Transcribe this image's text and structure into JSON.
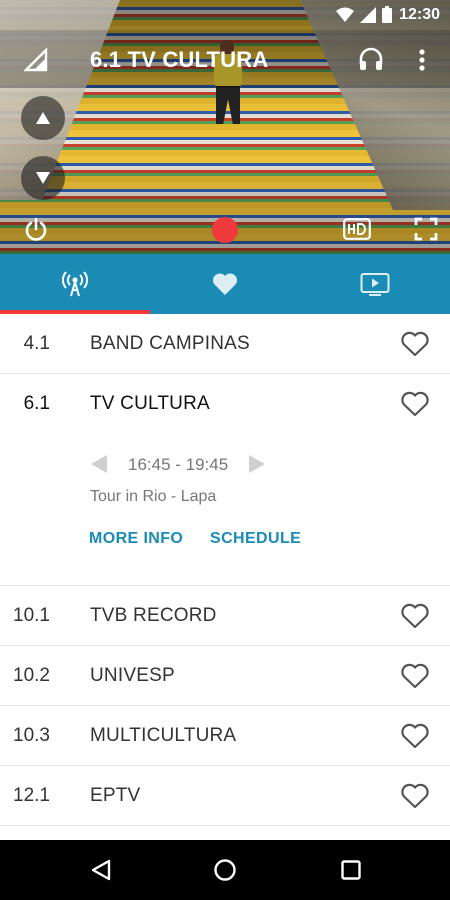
{
  "status_bar": {
    "time": "12:30"
  },
  "header": {
    "title": "6.1 TV CULTURA"
  },
  "tabs": [
    {
      "name": "live",
      "icon": "broadcast-antenna-icon",
      "selected": true
    },
    {
      "name": "favorites",
      "icon": "heart-icon",
      "selected": false
    },
    {
      "name": "recordings",
      "icon": "tv-play-icon",
      "selected": false
    }
  ],
  "channels": [
    {
      "number": "4.1",
      "name": "BAND CAMPINAS"
    },
    {
      "number": "6.1",
      "name": "TV CULTURA",
      "expanded": true,
      "program_time": "16:45 - 19:45",
      "program_title": "Tour in Rio - Lapa",
      "more_info_label": "MORE INFO",
      "schedule_label": "SCHEDULE"
    },
    {
      "number": "10.1",
      "name": "TVB RECORD"
    },
    {
      "number": "10.2",
      "name": "UNIVESP"
    },
    {
      "number": "10.3",
      "name": "MULTICULTURA"
    },
    {
      "number": "12.1",
      "name": "EPTV"
    }
  ],
  "colors": {
    "accent": "#1a8bb5",
    "indicator": "#ef3b3b",
    "record": "#f0393a"
  }
}
